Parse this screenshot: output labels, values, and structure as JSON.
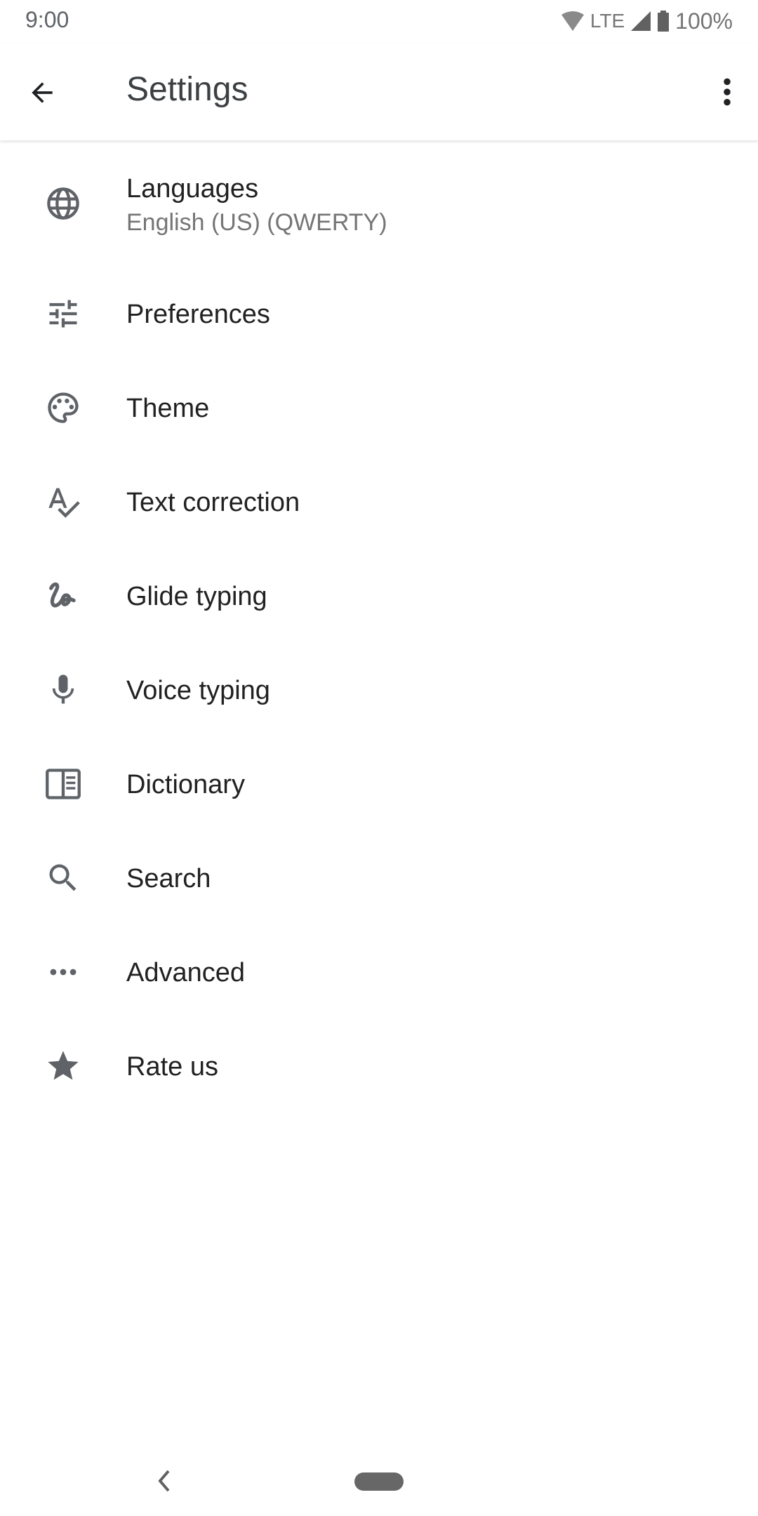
{
  "status_bar": {
    "time": "9:00",
    "network": "LTE",
    "battery": "100%",
    "icons": [
      "wifi-icon",
      "cell-signal-icon",
      "battery-icon"
    ]
  },
  "app_bar": {
    "title": "Settings",
    "back_icon": "arrow-back-icon",
    "menu_icon": "more-vert-icon"
  },
  "settings": [
    {
      "label": "Languages",
      "subtitle": "English (US) (QWERTY)",
      "icon": "globe-icon"
    },
    {
      "label": "Preferences",
      "icon": "tune-icon"
    },
    {
      "label": "Theme",
      "icon": "palette-icon"
    },
    {
      "label": "Text correction",
      "icon": "spellcheck-icon"
    },
    {
      "label": "Glide typing",
      "icon": "gesture-icon"
    },
    {
      "label": "Voice typing",
      "icon": "mic-icon"
    },
    {
      "label": "Dictionary",
      "icon": "book-icon"
    },
    {
      "label": "Search",
      "icon": "search-icon"
    },
    {
      "label": "Advanced",
      "icon": "more-horiz-icon"
    },
    {
      "label": "Rate us",
      "icon": "star-icon"
    }
  ],
  "colors": {
    "icon": "#5f6368",
    "primary_text": "#212121",
    "secondary_text": "#757575"
  }
}
